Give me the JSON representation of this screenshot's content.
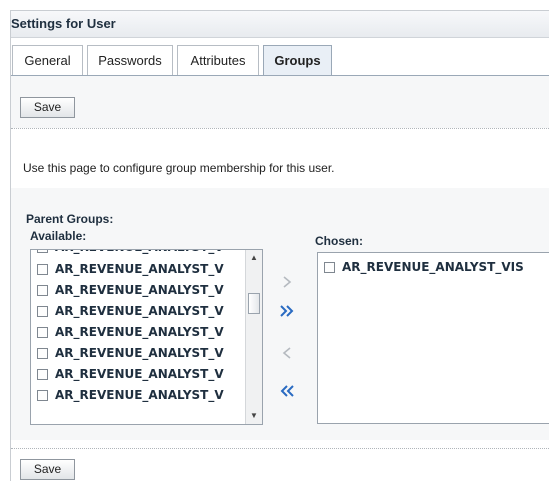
{
  "page": {
    "title": "Settings for User"
  },
  "tabs": [
    {
      "label": "General",
      "active": false
    },
    {
      "label": "Passwords",
      "active": false
    },
    {
      "label": "Attributes",
      "active": false
    },
    {
      "label": "Groups",
      "active": true
    }
  ],
  "toolbar": {
    "save_label": "Save"
  },
  "footer": {
    "save_label": "Save"
  },
  "description": "Use this page to configure group membership for this user.",
  "parent_groups": {
    "heading": "Parent Groups:",
    "available_label": "Available:",
    "chosen_label": "Chosen:",
    "available_items": [
      "AR_REVENUE_ANALYST_V",
      "AR_REVENUE_ANALYST_V",
      "AR_REVENUE_ANALYST_V",
      "AR_REVENUE_ANALYST_V",
      "AR_REVENUE_ANALYST_V",
      "AR_REVENUE_ANALYST_V",
      "AR_REVENUE_ANALYST_V",
      "AR_REVENUE_ANALYST_V"
    ],
    "chosen_items": [
      "AR_REVENUE_ANALYST_VIS"
    ]
  },
  "shuttle": {
    "move": "chevron-right-icon",
    "move_all": "double-chevron-right-icon",
    "remove": "chevron-left-icon",
    "remove_all": "double-chevron-left-icon"
  },
  "colors": {
    "accent": "#2a6bc2",
    "heading": "#1f2f3f",
    "active_tab_bg": "#e9eff6"
  }
}
